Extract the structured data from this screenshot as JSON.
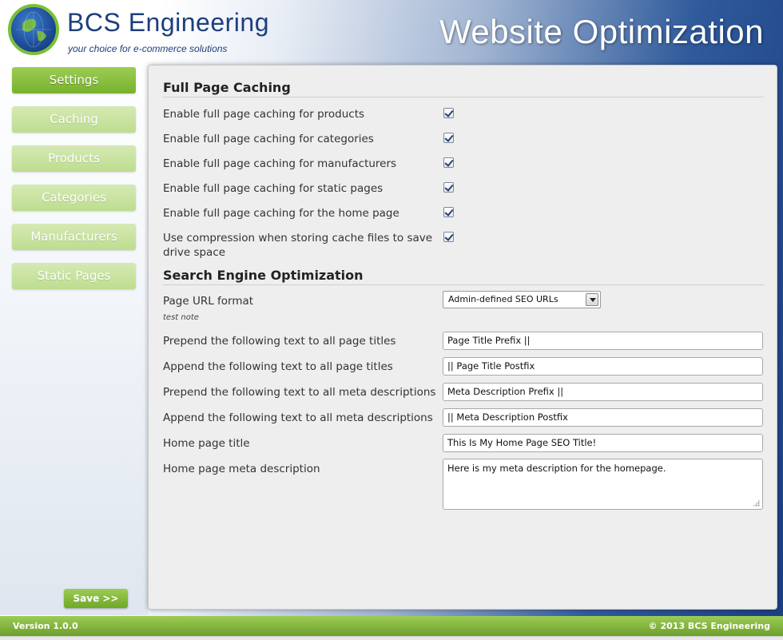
{
  "header": {
    "brand": "BCS Engineering",
    "tagline": "your choice for e-commerce solutions",
    "title": "Website Optimization"
  },
  "nav": {
    "items": [
      {
        "label": "Settings",
        "active": true
      },
      {
        "label": "Caching"
      },
      {
        "label": "Products"
      },
      {
        "label": "Categories"
      },
      {
        "label": "Manufacturers"
      },
      {
        "label": "Static Pages"
      }
    ],
    "save_label": "Save >>"
  },
  "caching": {
    "title": "Full Page Caching",
    "options": [
      {
        "label": "Enable full page caching for products",
        "checked": true
      },
      {
        "label": "Enable full page caching for categories",
        "checked": true
      },
      {
        "label": "Enable full page caching for manufacturers",
        "checked": true
      },
      {
        "label": "Enable full page caching for static pages",
        "checked": true
      },
      {
        "label": "Enable full page caching for the home page",
        "checked": true
      },
      {
        "label": "Use compression when storing cache files to save drive space",
        "checked": true
      }
    ]
  },
  "seo": {
    "title": "Search Engine Optimization",
    "url_format_label": "Page URL format",
    "url_format_value": "Admin-defined SEO URLs",
    "url_format_note": "test note",
    "fields": [
      {
        "label": "Prepend the following text to all page titles",
        "value": "Page Title Prefix ||"
      },
      {
        "label": "Append the following text to all page titles",
        "value": "|| Page Title Postfix"
      },
      {
        "label": "Prepend the following text to all meta descriptions",
        "value": "Meta Description Prefix ||"
      },
      {
        "label": "Append the following text to all meta descriptions",
        "value": "|| Meta Description Postfix"
      },
      {
        "label": "Home page title",
        "value": "This Is My Home Page SEO Title!"
      }
    ],
    "meta_label": "Home page meta description",
    "meta_value": "Here is my meta description for the homepage."
  },
  "footer": {
    "version": "Version 1.0.0",
    "copyright": "© 2013 BCS Engineering"
  },
  "colors": {
    "accent_green": "#78b22c",
    "brand_blue": "#1d3f7c",
    "header_dark_blue": "#1b3f82"
  }
}
